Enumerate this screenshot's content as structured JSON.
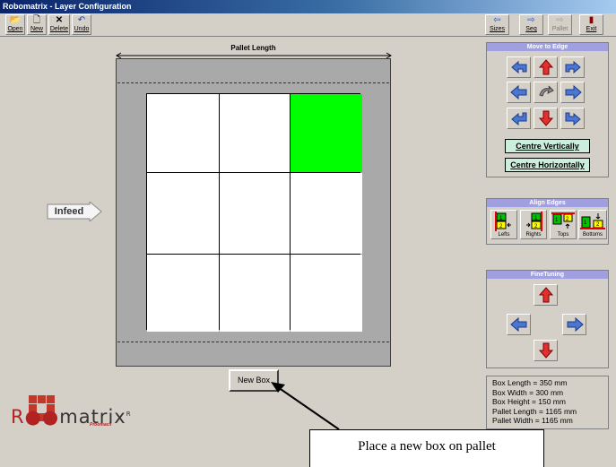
{
  "window": {
    "title": "Robomatrix - Layer Configuration"
  },
  "toolbar": {
    "open": "Open",
    "new": "New",
    "delete": "Delete",
    "undo": "Undo",
    "sizes": "Sizes",
    "seq": "Seq",
    "pallet": "Pallet",
    "exit": "Exit"
  },
  "workspace": {
    "pallet_length_label": "Pallet Length",
    "infeed_label": "Infeed",
    "new_box_label": "New Box",
    "selected_cell": "top-right",
    "colors": {
      "selected_box": "#00ff00",
      "pallet": "#a9a9a9",
      "box": "#ffffff"
    }
  },
  "move_to_edge": {
    "title": "Move to Edge",
    "centre_vertically": "Centre Vertically",
    "centre_horizontally": "Centre Horizontally"
  },
  "align_edges": {
    "title": "Align Edges",
    "lefts": "Lefts",
    "rights": "Rights",
    "tops": "Tops",
    "bottoms": "Bottoms",
    "icon_num_1": "1",
    "icon_num_2": "2"
  },
  "fine_tuning": {
    "title": "FineTuning"
  },
  "info": {
    "box_length": "Box Length = 350 mm",
    "box_width": "Box Width = 300 mm",
    "box_height": "Box Height = 150 mm",
    "pallet_length": "Pallet Length = 1165 mm",
    "pallet_width": "Pallet Width = 1165 mm"
  },
  "logo": {
    "text_prefix": "R",
    "text_rest": "matrix",
    "sup": "R",
    "sub": "Proomach"
  },
  "callout": {
    "text": "Place a new box on pallet"
  }
}
